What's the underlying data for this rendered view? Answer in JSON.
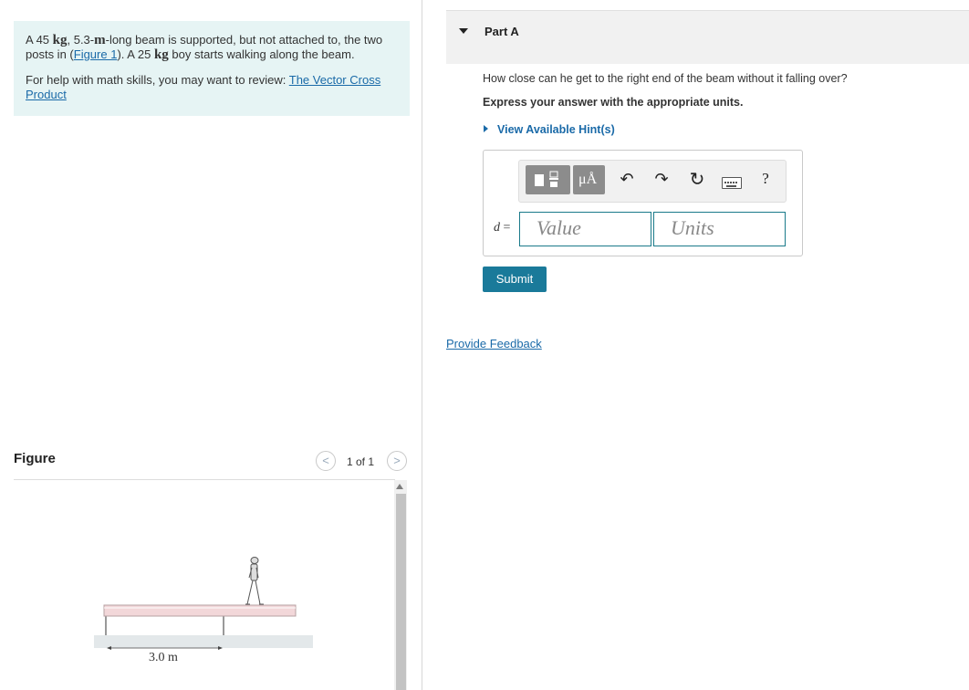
{
  "problem": {
    "line1_pre": "A 45 ",
    "kg_unit": "kg",
    "line1_mid": ", 5.3-",
    "m_unit": "m",
    "line1_post": "-long beam is supported, but not attached to, the two posts in (",
    "figure_link": "Figure 1",
    "line1_tail": "). A 25 ",
    "kg_unit2": "kg",
    "line1_end": " boy starts walking along the beam.",
    "help_text": "For help with math skills, you may want to review: ",
    "help_link": "The Vector Cross Product"
  },
  "figure": {
    "title": "Figure",
    "pager": "1 of 1",
    "prev_glyph": "<",
    "next_glyph": ">",
    "dimension_label": "3.0 m"
  },
  "part_a": {
    "title": "Part A",
    "question": "How close can he get to the right end of the beam without it falling over?",
    "instruction": "Express your answer with the appropriate units.",
    "hint_link": "View Available Hint(s)",
    "variable": "d",
    "equals": " =",
    "value_placeholder": "Value",
    "units_placeholder": "Units",
    "submit_label": "Submit",
    "feedback_link": "Provide Feedback"
  },
  "toolbar": {
    "units_glyph": "μÅ",
    "undo_glyph": "↶",
    "redo_glyph": "↷",
    "reset_glyph": "↻",
    "help_glyph": "?"
  },
  "colors": {
    "accent": "#1a7a9a",
    "link": "#1a6aa8",
    "problem_bg": "#e6f4f4",
    "beam_fill": "#f2d7d9"
  }
}
